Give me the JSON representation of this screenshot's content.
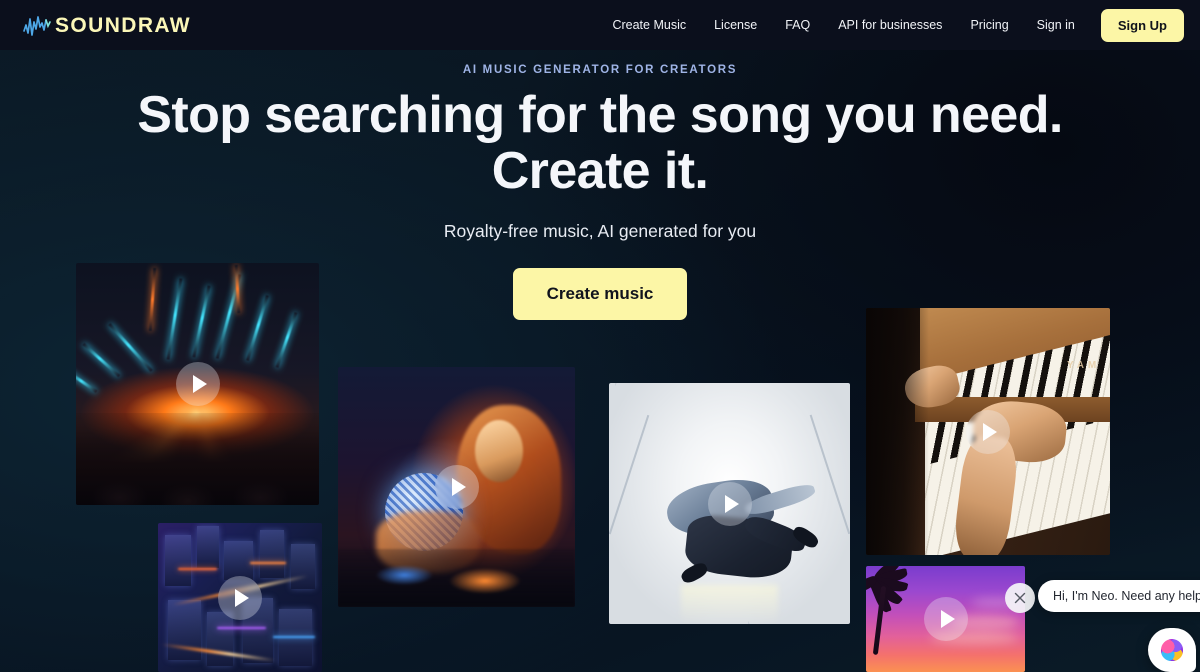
{
  "nav": {
    "logo_text": "SOUNDRAW",
    "logo_icon": "waveform-icon",
    "links": [
      {
        "label": "Create Music"
      },
      {
        "label": "License"
      },
      {
        "label": "FAQ"
      },
      {
        "label": "API for businesses"
      },
      {
        "label": "Pricing"
      },
      {
        "label": "Sign in"
      }
    ],
    "signup_label": "Sign Up"
  },
  "hero": {
    "eyebrow": "AI MUSIC GENERATOR FOR CREATORS",
    "title_line1": "Stop searching for the song you need.",
    "title_line2": "Create it.",
    "subtitle": "Royalty-free music, AI generated for you",
    "cta_label": "Create music"
  },
  "cards": [
    {
      "name": "concert-lasers",
      "play_icon": "play-icon"
    },
    {
      "name": "city-night",
      "play_icon": "play-icon"
    },
    {
      "name": "disco-ball-woman",
      "play_icon": "play-icon"
    },
    {
      "name": "breakdancer",
      "play_icon": "play-icon"
    },
    {
      "name": "piano-hands",
      "play_icon": "play-icon",
      "brand_text": "YAM"
    },
    {
      "name": "tropical-sunset",
      "play_icon": "play-icon"
    }
  ],
  "chat": {
    "message": "Hi, I'm Neo. Need any help?",
    "close_icon": "close-icon",
    "avatar_icon": "chat-avatar-icon"
  },
  "colors": {
    "accent_yellow": "#fcf6a6",
    "eyebrow_blue": "#9fb4e6",
    "nav_bg": "#0b0f1c",
    "page_bg": "#0a1620",
    "heading_text": "#f4f6fa"
  }
}
